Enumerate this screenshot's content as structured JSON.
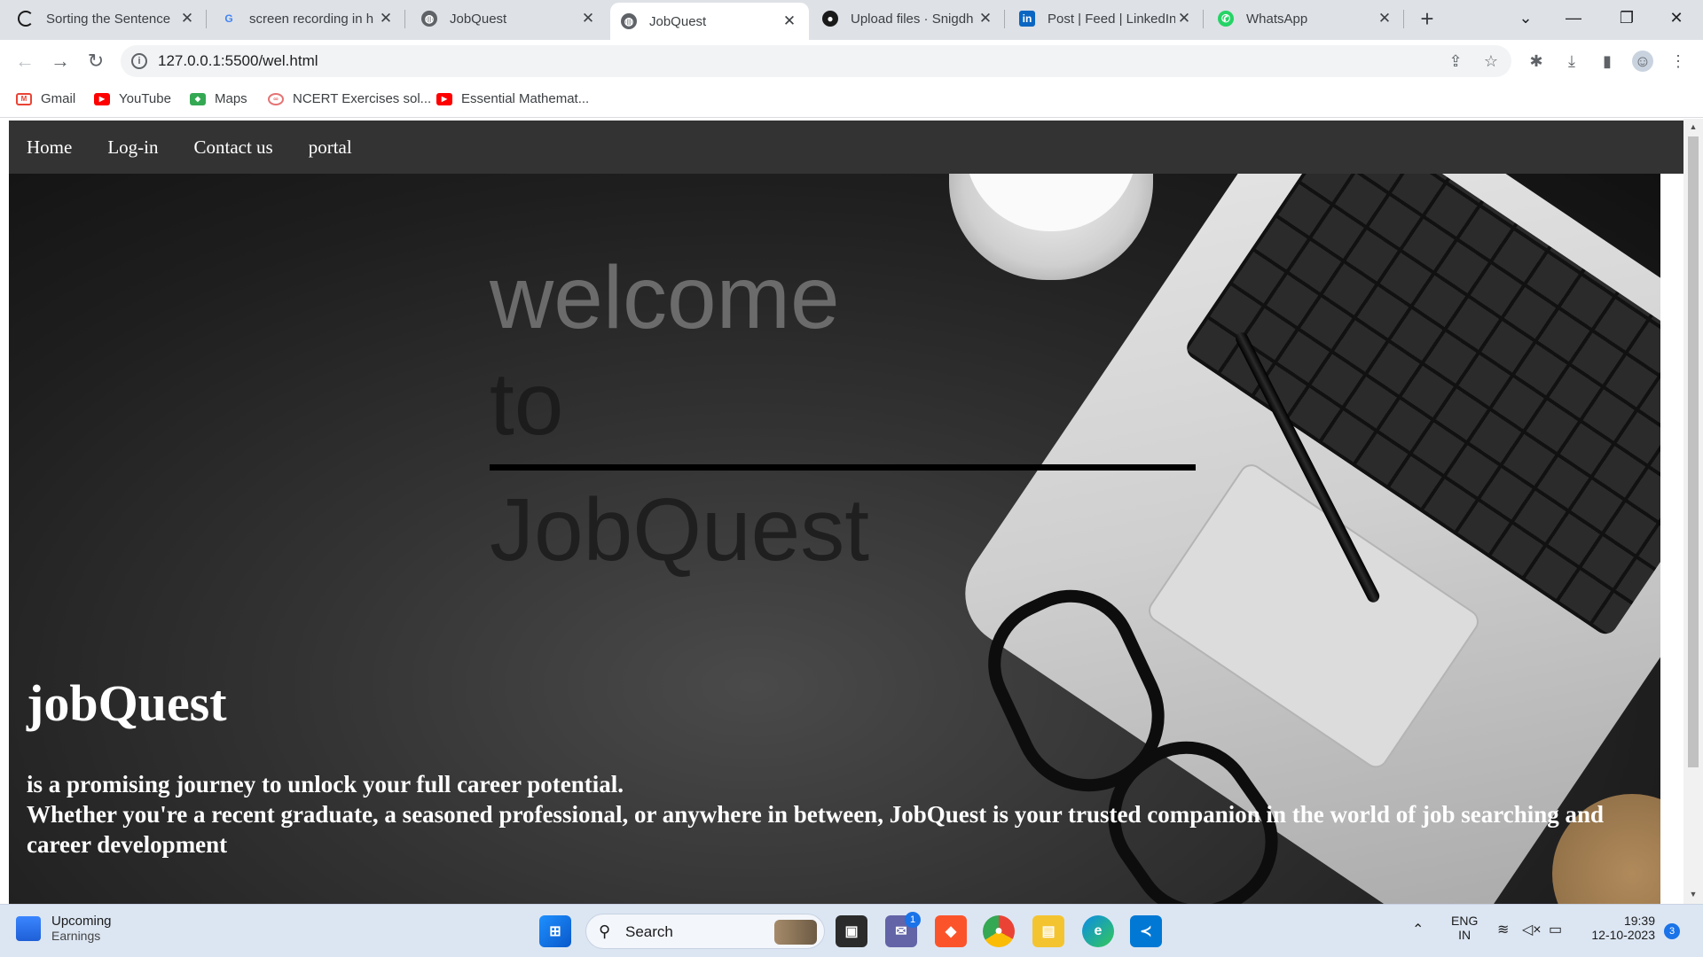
{
  "browser": {
    "tabs": [
      {
        "label": "Sorting the Sentence",
        "icon": "c-logo-icon",
        "color": "#1a1a1a"
      },
      {
        "label": "screen recording in h",
        "icon": "google-icon",
        "color": "#4285f4"
      },
      {
        "label": "JobQuest",
        "icon": "globe-icon",
        "color": "#5f6368"
      },
      {
        "label": "JobQuest",
        "icon": "globe-icon",
        "color": "#5f6368"
      },
      {
        "label": "Upload files · Snigdh",
        "icon": "github-icon",
        "color": "#1a1a1a"
      },
      {
        "label": "Post | Feed | LinkedIn",
        "icon": "linkedin-icon",
        "color": "#0a66c2"
      },
      {
        "label": "WhatsApp",
        "icon": "whatsapp-icon",
        "color": "#25d366"
      }
    ],
    "active_tab": 3,
    "url": "127.0.0.1:5500/wel.html",
    "bookmarks": [
      {
        "label": "Gmail",
        "color": "#ea4335"
      },
      {
        "label": "YouTube",
        "color": "#ff0000"
      },
      {
        "label": "Maps",
        "color": "#34a853"
      },
      {
        "label": "NCERT Exercises sol...",
        "color": "#e57373"
      },
      {
        "label": "Essential Mathemat...",
        "color": "#ff0000"
      }
    ]
  },
  "page": {
    "nav": [
      "Home",
      "Log-in",
      "Contact us",
      "portal"
    ],
    "welcome_line1": "welcome",
    "welcome_line2": "to",
    "welcome_line3": "JobQuest",
    "brand": "jobQuest",
    "tagline_line1": "is a promising journey to unlock your full career potential.",
    "tagline_line2": "Whether you're a recent graduate, a seasoned professional, or anywhere in between, JobQuest is your trusted companion in the world of job searching and career development"
  },
  "taskbar": {
    "widget_title": "Upcoming",
    "widget_subtitle": "Earnings",
    "search_placeholder": "Search",
    "lang_line1": "ENG",
    "lang_line2": "IN",
    "time": "19:39",
    "date": "12-10-2023",
    "notification_count": "3",
    "teams_badge": "1"
  }
}
